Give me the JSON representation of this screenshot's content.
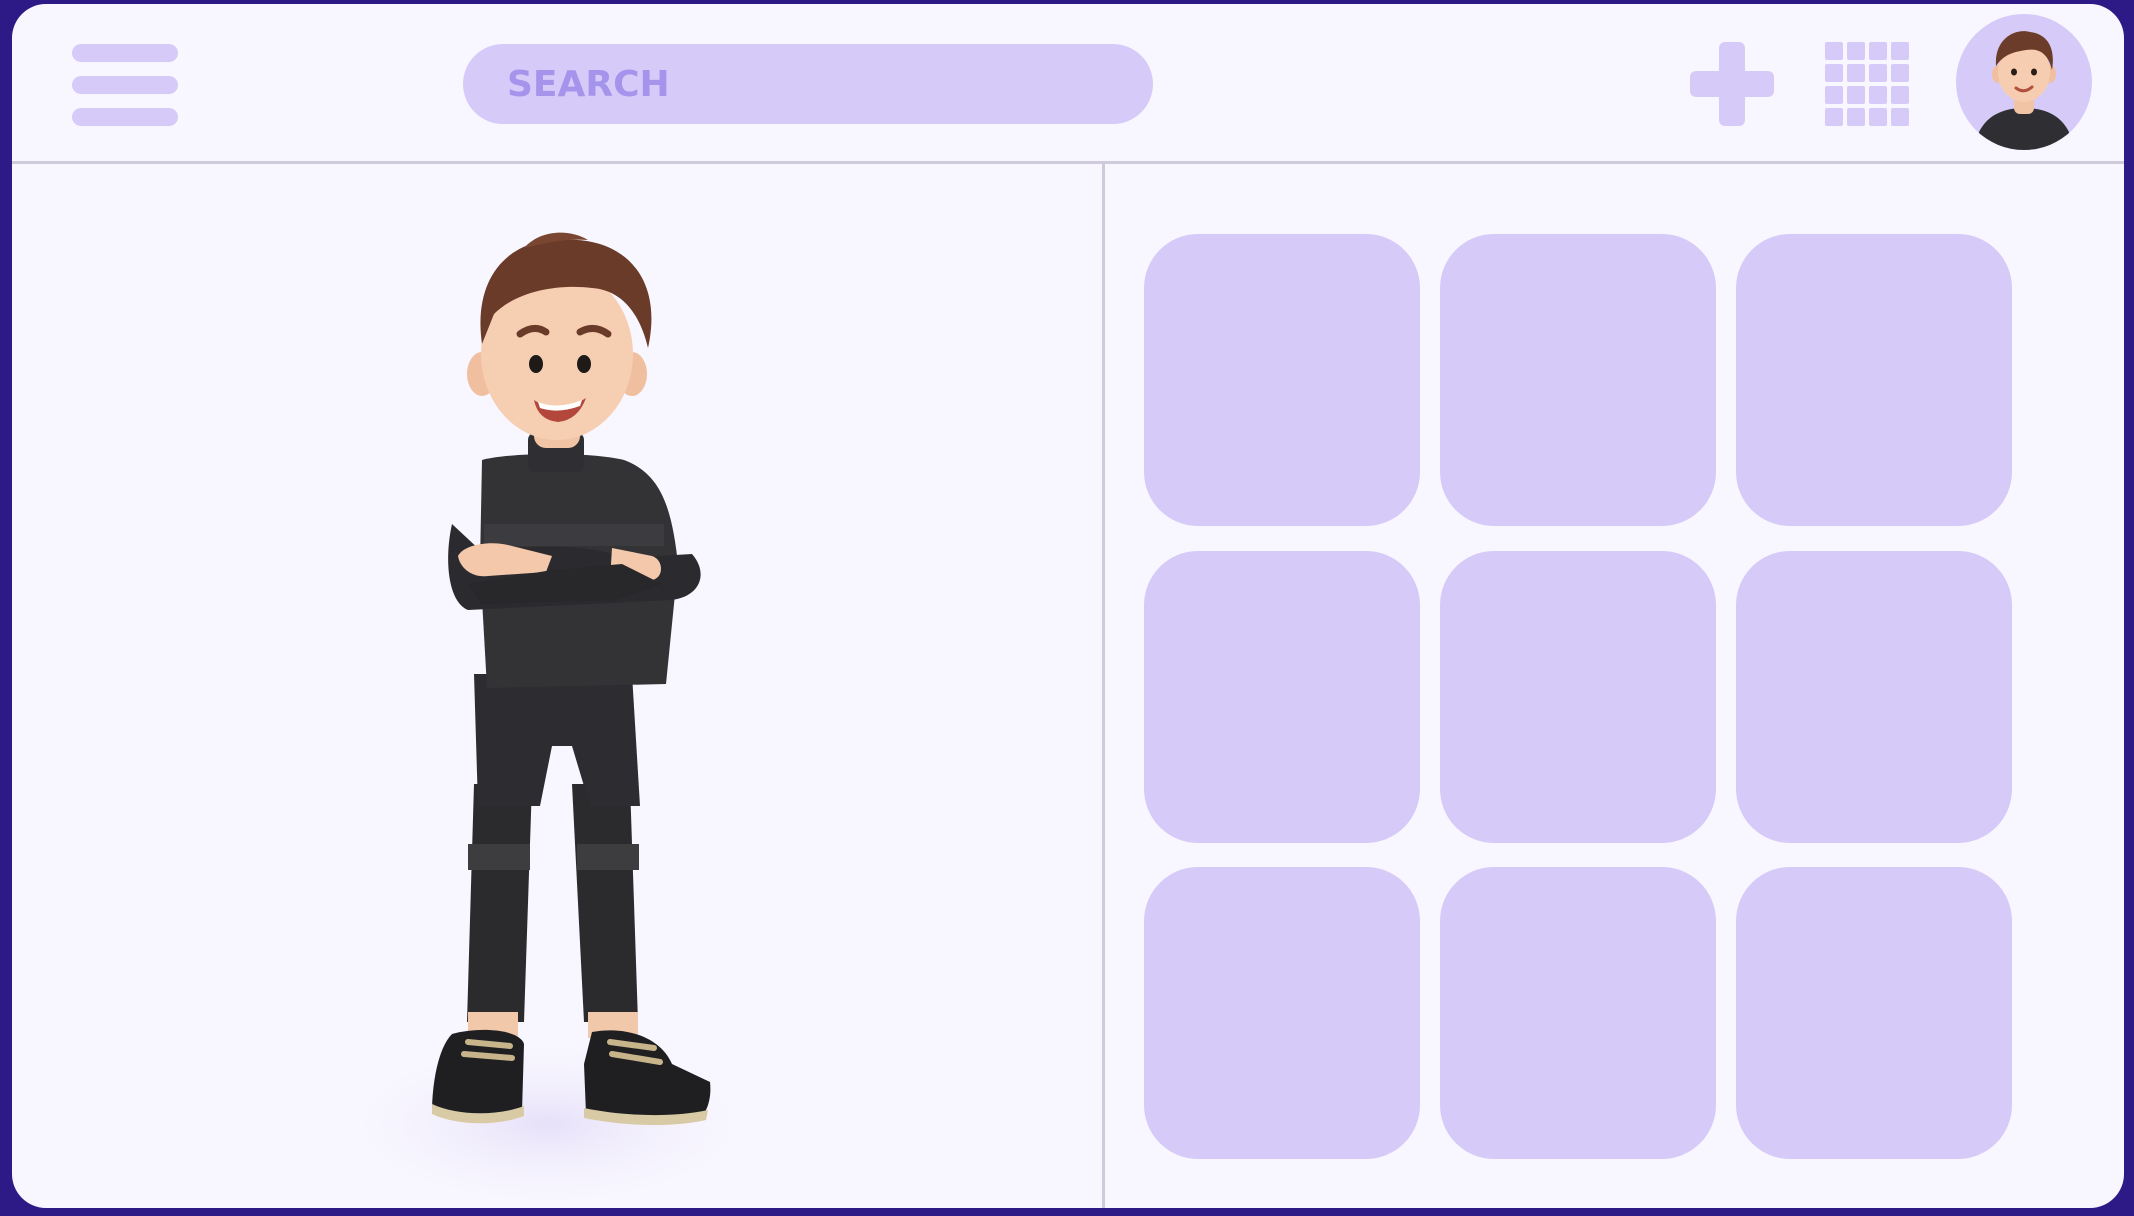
{
  "header": {
    "search": {
      "placeholder": "SEARCH"
    },
    "icons": {
      "menu": "hamburger-menu-icon",
      "add": "plus-icon",
      "apps": "grid-icon",
      "profile": "user-avatar"
    }
  },
  "main": {
    "illustration": "3d-character-arms-crossed",
    "tiles": [
      {
        "id": 1
      },
      {
        "id": 2
      },
      {
        "id": 3
      },
      {
        "id": 4
      },
      {
        "id": 5
      },
      {
        "id": 6
      },
      {
        "id": 7
      },
      {
        "id": 8
      },
      {
        "id": 9
      }
    ]
  },
  "colors": {
    "frame": "#2e1a86",
    "background": "#f8f6ff",
    "accent": "#d6cbf8",
    "accent_text": "#a594ec",
    "divider": "#cfcbdc"
  }
}
